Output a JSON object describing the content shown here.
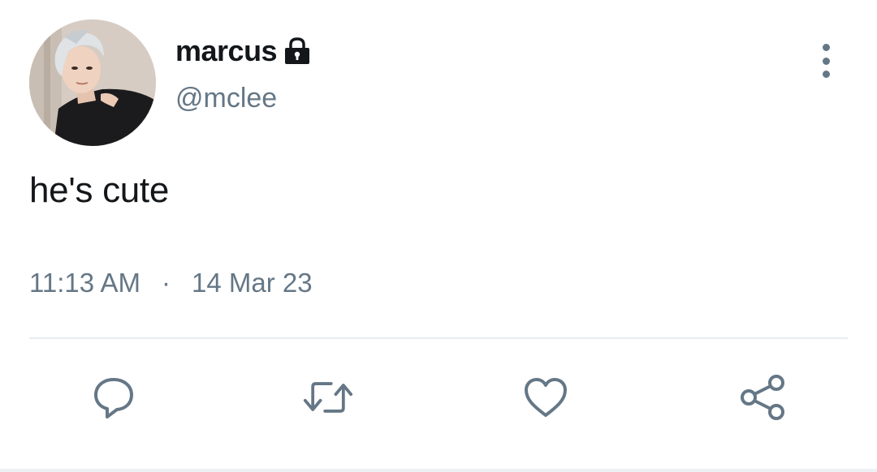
{
  "tweet": {
    "display_name": "marcus",
    "handle": "@mclee",
    "protected_icon": "lock-icon",
    "text": "he's cute",
    "time": "11:13 AM",
    "separator": "·",
    "date": "14 Mar 23"
  },
  "actions": [
    {
      "name": "reply",
      "icon": "reply-icon"
    },
    {
      "name": "retweet",
      "icon": "retweet-icon"
    },
    {
      "name": "like",
      "icon": "heart-icon"
    },
    {
      "name": "share",
      "icon": "share-icon"
    }
  ],
  "colors": {
    "text_primary": "#14171a",
    "text_secondary": "#657786",
    "divider": "#e6ecf0",
    "icon": "#657786"
  }
}
